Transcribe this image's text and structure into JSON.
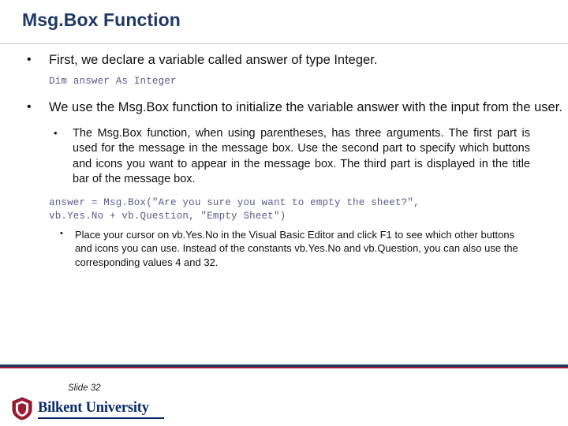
{
  "slide": {
    "title": "Msg.Box Function",
    "bullets": {
      "level1_first": "First, we declare a variable called answer of type Integer.",
      "code_declare": "Dim answer As Integer",
      "level1_second": "We use the Msg.Box function to initialize the variable answer with the input from the user.",
      "level2_first": "The Msg.Box function, when using parentheses, has three arguments. The first part is used for the message in the message box. Use the second part to specify which buttons and icons you want to appear in the message box. The third part is displayed in the title bar of the message box.",
      "code_msgbox_line1": "answer = Msg.Box(\"Are you sure you want to empty the sheet?\",",
      "code_msgbox_line2": "vb.Yes.No + vb.Question, \"Empty Sheet\")",
      "level3_first": "Place your cursor on vb.Yes.No in the Visual Basic Editor and click F1 to see which other buttons and icons you can use. Instead of the constants vb.Yes.No and vb.Question, you can also use the corresponding values 4 and 32."
    },
    "bullet_glyphs": {
      "level1": "•",
      "level2": "•",
      "level3": "•"
    },
    "footer": {
      "slide_number": "Slide 32",
      "logo_text": "Bilkent University"
    },
    "colors": {
      "title": "#1f3864",
      "code": "#5a5a8a",
      "accent_bar_top": "#1f3864",
      "accent_bar_bottom": "#9e1b32",
      "logo": "#0b2a6b"
    }
  }
}
